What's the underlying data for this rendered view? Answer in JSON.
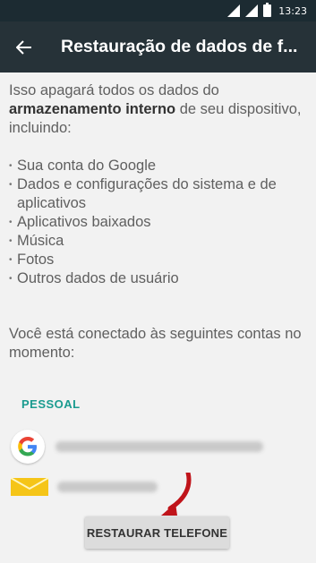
{
  "status_bar": {
    "time": "13:23"
  },
  "app_bar": {
    "title": "Restauração de dados de f..."
  },
  "intro": {
    "text_before": "Isso apagará todos os dados do ",
    "bold": "armazenamento interno",
    "text_after": " de seu dispositivo, incluindo:"
  },
  "items": [
    "Sua conta do Google",
    "Dados e configurações do sistema e de aplicativos",
    "Aplicativos baixados",
    "Música",
    "Fotos",
    "Outros dados de usuário"
  ],
  "accounts_intro": "Você está conectado às seguintes contas no momento:",
  "section_label": "PESSOAL",
  "button_label": "RESTAURAR TELEFONE",
  "colors": {
    "app_bar": "#263238",
    "accent": "#1a9b8f"
  }
}
